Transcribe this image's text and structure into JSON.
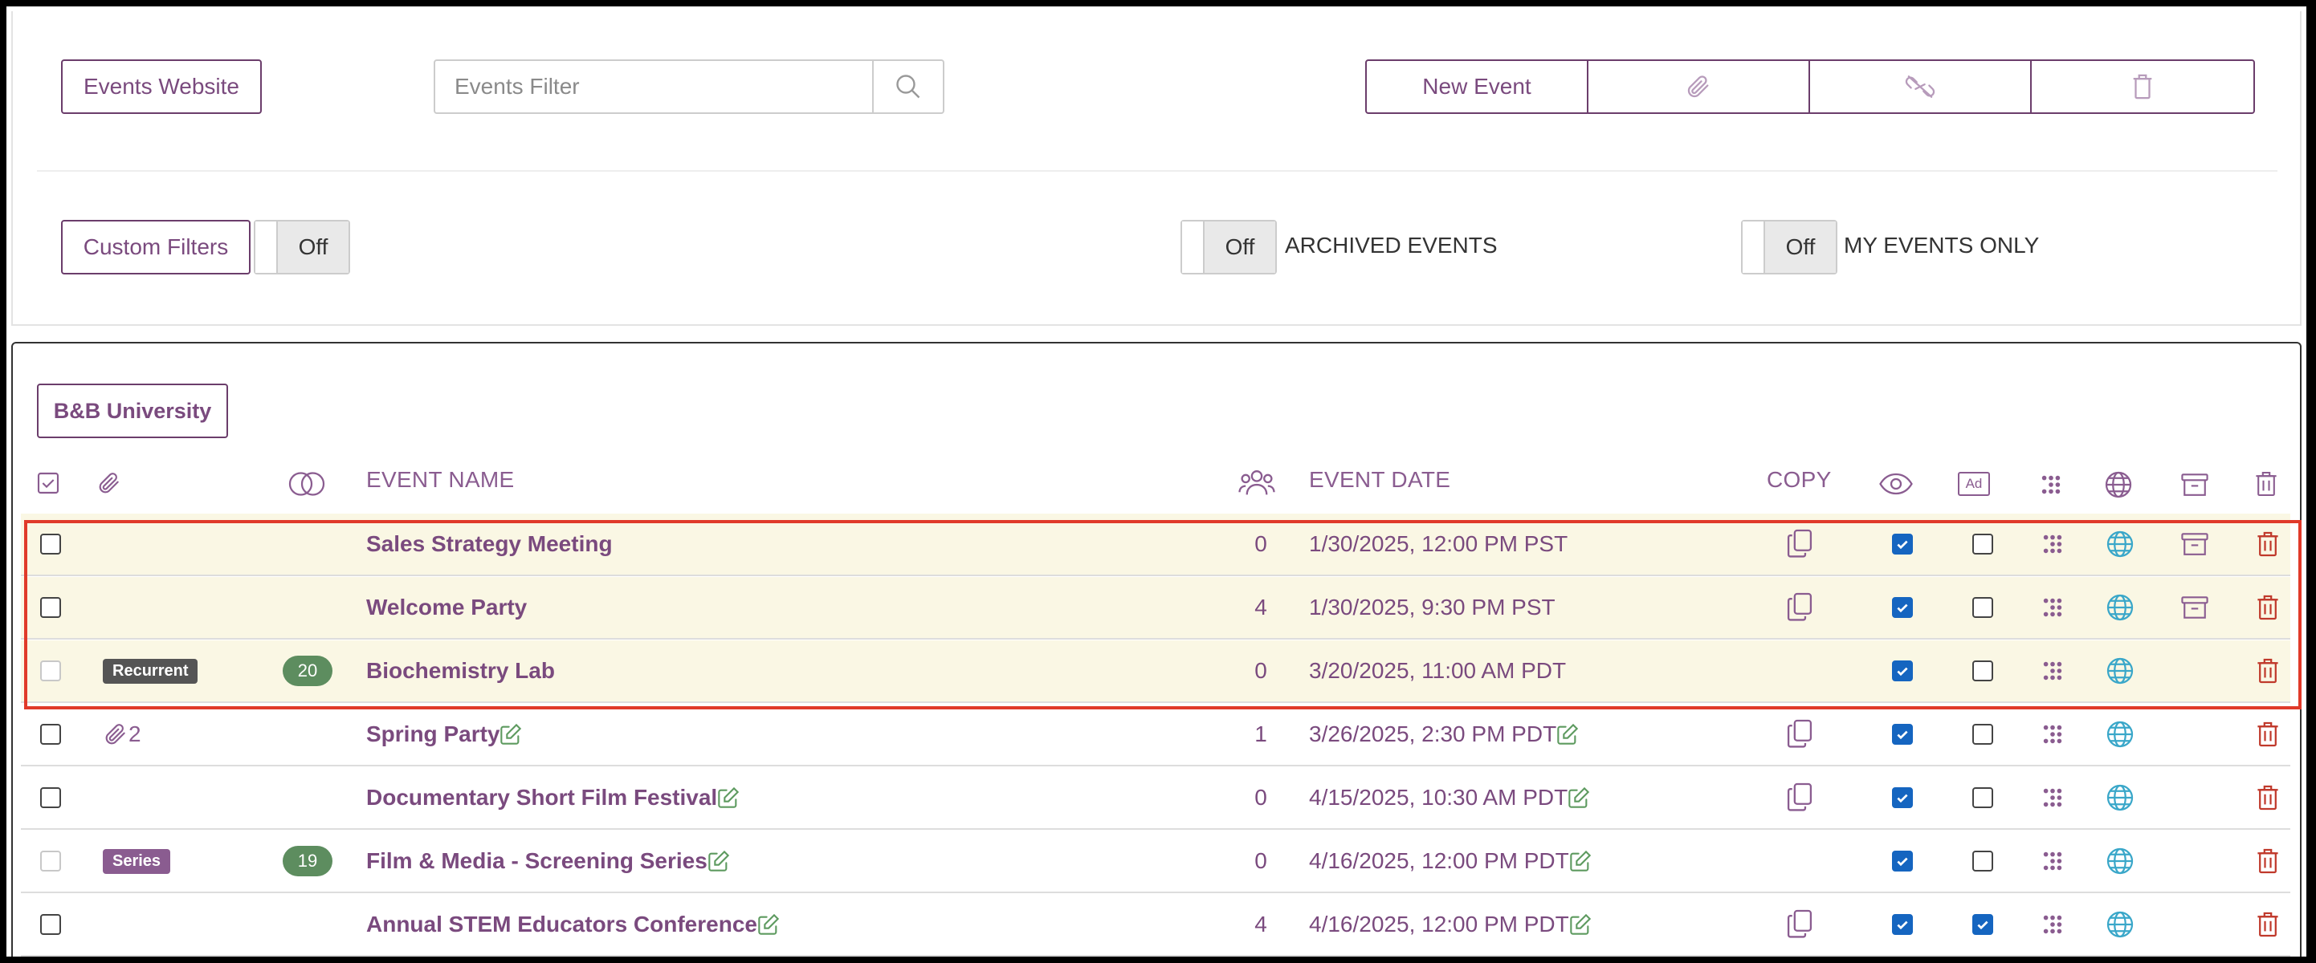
{
  "toolbar": {
    "events_website": "Events Website",
    "filter_placeholder": "Events Filter",
    "new_event": "New Event"
  },
  "filters": {
    "custom_filters": "Custom Filters",
    "custom_toggle": "Off",
    "archived_toggle": "Off",
    "archived_label": "ARCHIVED EVENTS",
    "my_events_toggle": "Off",
    "my_events_label": "MY EVENTS ONLY"
  },
  "group": {
    "name": "B&B University"
  },
  "table": {
    "headers": {
      "event_name": "EVENT NAME",
      "event_date": "EVENT DATE",
      "copy": "COPY",
      "ad": "Ad"
    },
    "rows": [
      {
        "name": "Sales Strategy Meeting",
        "attendees": "0",
        "date": "1/30/2025, 12:00 PM PST",
        "badge": "",
        "badge_color": "",
        "count": "",
        "attach": "",
        "copy": true,
        "visible": true,
        "ad": false,
        "archive": true,
        "select_disabled": false,
        "editable": false,
        "highlight": true
      },
      {
        "name": "Welcome Party",
        "attendees": "4",
        "date": "1/30/2025, 9:30 PM PST",
        "badge": "",
        "badge_color": "",
        "count": "",
        "attach": "",
        "copy": true,
        "visible": true,
        "ad": false,
        "archive": true,
        "select_disabled": false,
        "editable": false,
        "highlight": true
      },
      {
        "name": "Biochemistry Lab",
        "attendees": "0",
        "date": "3/20/2025, 11:00 AM PDT",
        "badge": "Recurrent",
        "badge_color": "#555555",
        "count": "20",
        "attach": "",
        "copy": false,
        "visible": true,
        "ad": false,
        "archive": false,
        "select_disabled": true,
        "editable": false,
        "highlight": true
      },
      {
        "name": "Spring Party",
        "attendees": "1",
        "date": "3/26/2025, 2:30 PM PDT",
        "badge": "",
        "badge_color": "",
        "count": "",
        "attach": "2",
        "copy": true,
        "visible": true,
        "ad": false,
        "archive": false,
        "select_disabled": false,
        "editable": true,
        "highlight": false
      },
      {
        "name": "Documentary Short Film Festival",
        "attendees": "0",
        "date": "4/15/2025, 10:30 AM PDT",
        "badge": "",
        "badge_color": "",
        "count": "",
        "attach": "",
        "copy": true,
        "visible": true,
        "ad": false,
        "archive": false,
        "select_disabled": false,
        "editable": true,
        "highlight": false
      },
      {
        "name": "Film & Media - Screening Series",
        "attendees": "0",
        "date": "4/16/2025, 12:00 PM PDT",
        "badge": "Series",
        "badge_color": "#8a5c90",
        "count": "19",
        "attach": "",
        "copy": false,
        "visible": true,
        "ad": false,
        "archive": false,
        "select_disabled": true,
        "editable": true,
        "highlight": false
      },
      {
        "name": "Annual STEM Educators Conference",
        "attendees": "4",
        "date": "4/16/2025, 12:00 PM PDT",
        "badge": "",
        "badge_color": "",
        "count": "",
        "attach": "",
        "copy": true,
        "visible": true,
        "ad": true,
        "archive": false,
        "select_disabled": false,
        "editable": true,
        "highlight": false
      }
    ]
  },
  "colors": {
    "brand_purple": "#7a4a7e",
    "globe_blue": "#3aa7c9",
    "delete_red": "#c0392b",
    "highlight_bg": "#faf7e4",
    "count_green": "#5d8d5f"
  }
}
